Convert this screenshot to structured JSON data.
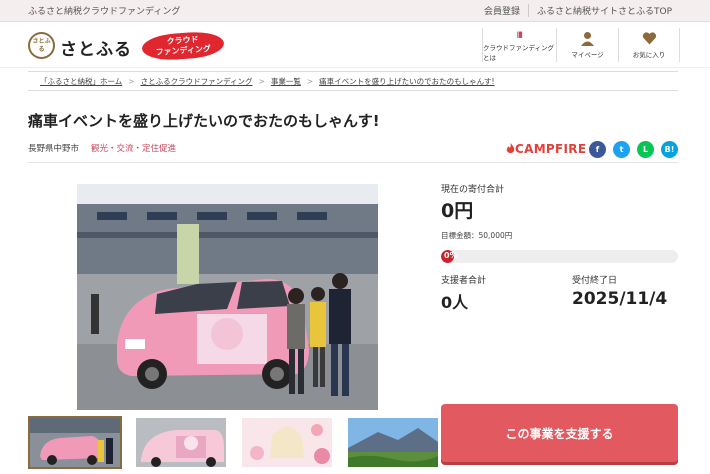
{
  "topbar": {
    "site_name": "ふるさと納税クラウドファンディング",
    "register": "会員登録",
    "top_link": "ふるさと納税サイトさとふるTOP"
  },
  "header": {
    "logo_mark": "さとふる",
    "logo_text": "さとふる",
    "cf_badge_line1": "クラウド",
    "cf_badge_line2": "ファンディング",
    "nav": [
      {
        "label": "クラウドファンディングとは",
        "icon": "book-icon"
      },
      {
        "label": "マイページ",
        "icon": "person-icon"
      },
      {
        "label": "お気に入り",
        "icon": "heart-icon"
      }
    ]
  },
  "breadcrumb": [
    "「ふるさと納税」ホーム",
    "さとふるクラウドファンディング",
    "事業一覧",
    "痛車イベントを盛り上げたいのでおたのもしゃんす!"
  ],
  "project": {
    "title": "痛車イベントを盛り上げたいのでおたのもしゃんす!",
    "location": "長野県中野市",
    "category": "観光・交流・定住促進",
    "partner": "CAMPFIRE"
  },
  "social": [
    {
      "icon": "facebook-icon",
      "glyph": "f",
      "color": "#3b5998"
    },
    {
      "icon": "twitter-icon",
      "glyph": "t",
      "color": "#1da1f2"
    },
    {
      "icon": "line-icon",
      "glyph": "L",
      "color": "#06c755"
    },
    {
      "icon": "hatena-icon",
      "glyph": "B!",
      "color": "#00a4de"
    }
  ],
  "stats": {
    "total_label": "現在の寄付合計",
    "total_value": "0円",
    "goal_text": "目標金額：50,000円",
    "progress_percent": 0,
    "progress_label": "0%",
    "supporters_label": "支援者合計",
    "supporters_value": "0人",
    "deadline_label": "受付終了日",
    "deadline_value": "2025/11/4"
  },
  "support_button": "この事業を支援する",
  "colors": {
    "accent": "#e25a5f",
    "campfire": "#e0413b",
    "brand": "#8a6b3d"
  }
}
